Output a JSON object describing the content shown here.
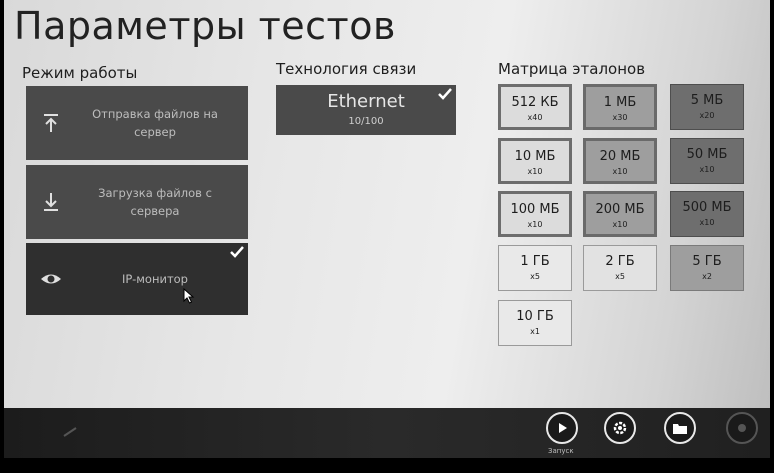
{
  "title": "Параметры тестов",
  "sections": {
    "mode": "Режим работы",
    "tech": "Технология связи",
    "matrix": "Матрица эталонов"
  },
  "modes": [
    {
      "label": "Отправка файлов на сервер",
      "icon": "upload-icon",
      "selected": false
    },
    {
      "label": "Загрузка файлов с сервера",
      "icon": "download-icon",
      "selected": false
    },
    {
      "label": "IP-монитор",
      "icon": "eye-icon",
      "selected": true
    }
  ],
  "tech": {
    "name": "Ethernet",
    "speed": "10/100",
    "selected": true
  },
  "matrix": [
    {
      "size": "512 КБ",
      "count": "x40"
    },
    {
      "size": "1 МБ",
      "count": "x30"
    },
    {
      "size": "5 МБ",
      "count": "x20"
    },
    {
      "size": "10 МБ",
      "count": "x10"
    },
    {
      "size": "20 МБ",
      "count": "x10"
    },
    {
      "size": "50 МБ",
      "count": "x10"
    },
    {
      "size": "100 МБ",
      "count": "x10"
    },
    {
      "size": "200 МБ",
      "count": "x10"
    },
    {
      "size": "500 МБ",
      "count": "x10"
    },
    {
      "size": "1 ГБ",
      "count": "x5"
    },
    {
      "size": "2 ГБ",
      "count": "x5"
    },
    {
      "size": "5 ГБ",
      "count": "x2"
    },
    {
      "size": "10 ГБ",
      "count": "x1"
    }
  ],
  "bottom": {
    "start_label": "Запуск"
  },
  "colors": {
    "tile": "#4a4a4a",
    "accent_border": "#6d6d6d"
  }
}
